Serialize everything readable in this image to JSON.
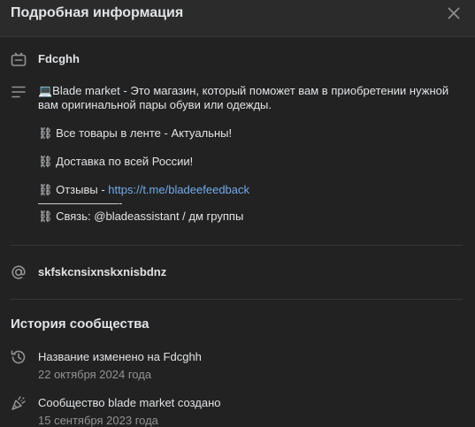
{
  "header": {
    "title": "Подробная информация"
  },
  "info": {
    "name": "Fdcghh",
    "description": {
      "line1": "💻Blade market - Это магазин, который поможет вам в приобретении нужной",
      "line2": "вам оригинальной пары обуви или одежды.",
      "line3": "⛓ Все товары в ленте - Актуальны!",
      "line4": "⛓ Доставка по всей России!",
      "line5_prefix": "⛓ Отзывы - ",
      "line5_link": "https://t.me/bladeefeedback",
      "line6": "———————-",
      "line7": "⛓ Связь: @bladeassistant / дм группы"
    },
    "address": "skfskcnsixnskxnisbdnz"
  },
  "history": {
    "title": "История сообщества",
    "items": [
      {
        "icon": "history-icon",
        "title": "Название изменено на Fdcghh",
        "date": "22 октября 2024 года"
      },
      {
        "icon": "party-popper-icon",
        "title": "Сообщество blade market создано",
        "date": "15 сентября 2023 года"
      }
    ]
  },
  "colors": {
    "background": "#222222",
    "header": "#2b2b2b",
    "link": "#71aaeb",
    "secondary_text": "#939393",
    "divider": "#363738"
  }
}
